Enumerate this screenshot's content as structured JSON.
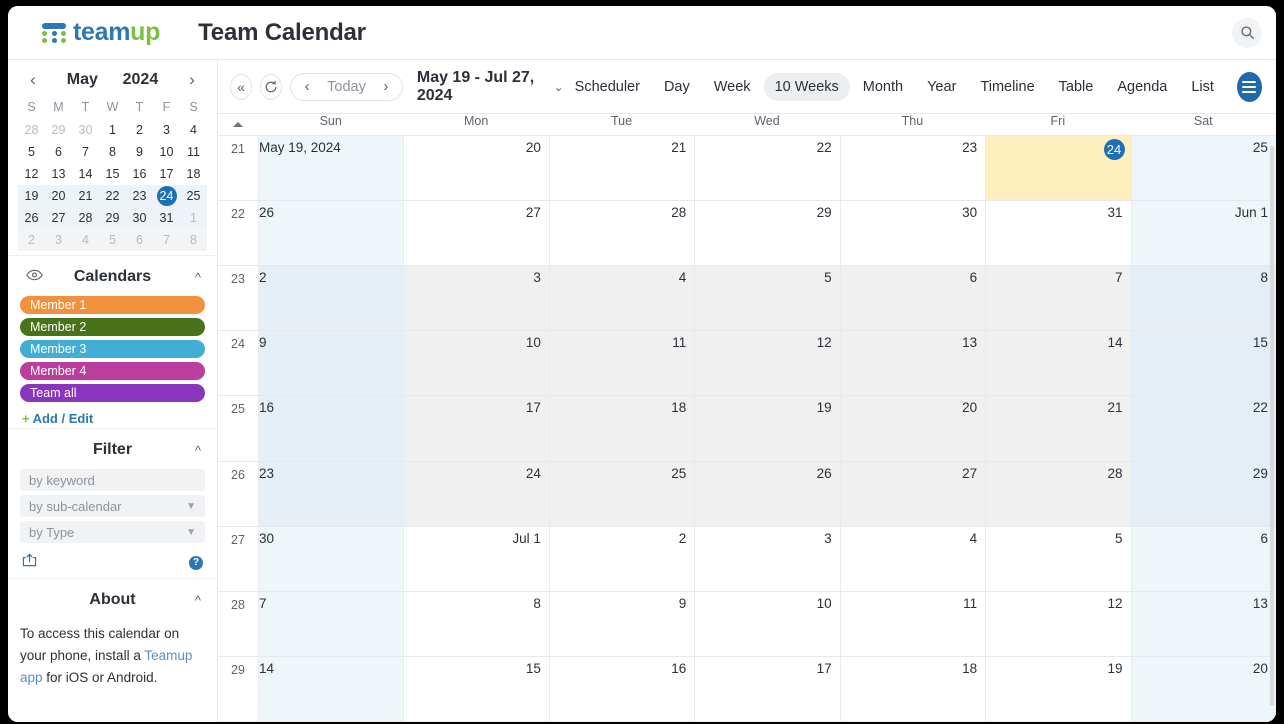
{
  "header": {
    "logo_text_1": "team",
    "logo_text_2": "up",
    "logo_icon": "teamup-grid-logo",
    "calendar_title": "Team Calendar",
    "search_icon": "search-icon"
  },
  "sidebar": {
    "mini_calendar": {
      "prev_icon": "chevron-left-icon",
      "next_icon": "chevron-right-icon",
      "month": "May",
      "year": "2024",
      "dow": [
        "S",
        "M",
        "T",
        "W",
        "T",
        "F",
        "S"
      ],
      "weeks": [
        {
          "highlight": "none",
          "days": [
            {
              "n": "28",
              "mute": true
            },
            {
              "n": "29",
              "mute": true
            },
            {
              "n": "30",
              "mute": true
            },
            {
              "n": "1"
            },
            {
              "n": "2"
            },
            {
              "n": "3"
            },
            {
              "n": "4"
            }
          ]
        },
        {
          "highlight": "none",
          "days": [
            {
              "n": "5"
            },
            {
              "n": "6"
            },
            {
              "n": "7"
            },
            {
              "n": "8"
            },
            {
              "n": "9"
            },
            {
              "n": "10"
            },
            {
              "n": "11"
            }
          ]
        },
        {
          "highlight": "none",
          "days": [
            {
              "n": "12"
            },
            {
              "n": "13"
            },
            {
              "n": "14"
            },
            {
              "n": "15"
            },
            {
              "n": "16"
            },
            {
              "n": "17"
            },
            {
              "n": "18"
            }
          ]
        },
        {
          "highlight": "blue",
          "days": [
            {
              "n": "19"
            },
            {
              "n": "20"
            },
            {
              "n": "21"
            },
            {
              "n": "22"
            },
            {
              "n": "23"
            },
            {
              "n": "24",
              "today": true
            },
            {
              "n": "25"
            }
          ]
        },
        {
          "highlight": "blue",
          "days": [
            {
              "n": "26"
            },
            {
              "n": "27"
            },
            {
              "n": "28"
            },
            {
              "n": "29"
            },
            {
              "n": "30"
            },
            {
              "n": "31"
            },
            {
              "n": "1",
              "mute": true
            }
          ]
        },
        {
          "highlight": "gray",
          "days": [
            {
              "n": "2",
              "mute": true
            },
            {
              "n": "3",
              "mute": true
            },
            {
              "n": "4",
              "mute": true
            },
            {
              "n": "5",
              "mute": true
            },
            {
              "n": "6",
              "mute": true
            },
            {
              "n": "7",
              "mute": true
            },
            {
              "n": "8",
              "mute": true
            }
          ]
        }
      ]
    },
    "calendars": {
      "title": "Calendars",
      "eye_icon": "eye-icon",
      "collapse_icon": "chevron-up-icon",
      "items": [
        {
          "label": "Member 1",
          "color": "#f2913d"
        },
        {
          "label": "Member 2",
          "color": "#49731b"
        },
        {
          "label": "Member 3",
          "color": "#41aed4"
        },
        {
          "label": "Member 4",
          "color": "#bb3d9e"
        },
        {
          "label": "Team all",
          "color": "#8a35bd"
        }
      ],
      "add_edit_label": "Add / Edit",
      "add_edit_plus": "+"
    },
    "filter": {
      "title": "Filter",
      "collapse_icon": "chevron-up-icon",
      "keyword_placeholder": "by keyword",
      "subcalendar_label": "by sub-calendar",
      "type_label": "by Type",
      "share_icon": "share-export-icon",
      "help_icon": "help-icon",
      "help_label": "?"
    },
    "about": {
      "title": "About",
      "collapse_icon": "chevron-up-icon",
      "text_before": "To access this calendar on your phone, install a ",
      "link_text": "Teamup app",
      "text_after": " for iOS or Android."
    }
  },
  "toolbar": {
    "collapse_icon": "double-chevron-left-icon",
    "refresh_icon": "refresh-icon",
    "prev_icon": "chevron-left-icon",
    "today_label": "Today",
    "next_icon": "chevron-right-icon",
    "range_label": "May 19 - Jul 27, 2024",
    "range_caret": "chevron-down-icon",
    "views": [
      {
        "label": "Scheduler",
        "active": false
      },
      {
        "label": "Day",
        "active": false
      },
      {
        "label": "Week",
        "active": false
      },
      {
        "label": "10 Weeks",
        "active": true
      },
      {
        "label": "Month",
        "active": false
      },
      {
        "label": "Year",
        "active": false
      },
      {
        "label": "Timeline",
        "active": false
      },
      {
        "label": "Table",
        "active": false
      },
      {
        "label": "Agenda",
        "active": false
      },
      {
        "label": "List",
        "active": false
      }
    ],
    "menu_icon": "hamburger-menu-icon"
  },
  "grid": {
    "sort_icon": "sort-ascending-icon",
    "dow": [
      "Sun",
      "Mon",
      "Tue",
      "Wed",
      "Thu",
      "Fri",
      "Sat"
    ],
    "weeks": [
      {
        "wk": "21",
        "alt": false,
        "days": [
          {
            "n": "May 19, 2024"
          },
          {
            "n": "20"
          },
          {
            "n": "21"
          },
          {
            "n": "22"
          },
          {
            "n": "23"
          },
          {
            "n": "24",
            "today": true
          },
          {
            "n": "25"
          }
        ]
      },
      {
        "wk": "22",
        "alt": false,
        "days": [
          {
            "n": "26"
          },
          {
            "n": "27"
          },
          {
            "n": "28"
          },
          {
            "n": "29"
          },
          {
            "n": "30"
          },
          {
            "n": "31"
          },
          {
            "n": "Jun 1"
          }
        ]
      },
      {
        "wk": "23",
        "alt": true,
        "days": [
          {
            "n": "2"
          },
          {
            "n": "3"
          },
          {
            "n": "4"
          },
          {
            "n": "5"
          },
          {
            "n": "6"
          },
          {
            "n": "7"
          },
          {
            "n": "8"
          }
        ]
      },
      {
        "wk": "24",
        "alt": true,
        "days": [
          {
            "n": "9"
          },
          {
            "n": "10"
          },
          {
            "n": "11"
          },
          {
            "n": "12"
          },
          {
            "n": "13"
          },
          {
            "n": "14"
          },
          {
            "n": "15"
          }
        ]
      },
      {
        "wk": "25",
        "alt": true,
        "days": [
          {
            "n": "16"
          },
          {
            "n": "17"
          },
          {
            "n": "18"
          },
          {
            "n": "19"
          },
          {
            "n": "20"
          },
          {
            "n": "21"
          },
          {
            "n": "22"
          }
        ]
      },
      {
        "wk": "26",
        "alt": true,
        "days": [
          {
            "n": "23"
          },
          {
            "n": "24"
          },
          {
            "n": "25"
          },
          {
            "n": "26"
          },
          {
            "n": "27"
          },
          {
            "n": "28"
          },
          {
            "n": "29"
          }
        ]
      },
      {
        "wk": "27",
        "alt": false,
        "days": [
          {
            "n": "30"
          },
          {
            "n": "Jul 1"
          },
          {
            "n": "2"
          },
          {
            "n": "3"
          },
          {
            "n": "4"
          },
          {
            "n": "5"
          },
          {
            "n": "6"
          }
        ]
      },
      {
        "wk": "28",
        "alt": false,
        "days": [
          {
            "n": "7"
          },
          {
            "n": "8"
          },
          {
            "n": "9"
          },
          {
            "n": "10"
          },
          {
            "n": "11"
          },
          {
            "n": "12"
          },
          {
            "n": "13"
          }
        ]
      },
      {
        "wk": "29",
        "alt": false,
        "days": [
          {
            "n": "14"
          },
          {
            "n": "15"
          },
          {
            "n": "16"
          },
          {
            "n": "17"
          },
          {
            "n": "18"
          },
          {
            "n": "19"
          },
          {
            "n": "20"
          }
        ]
      }
    ]
  }
}
